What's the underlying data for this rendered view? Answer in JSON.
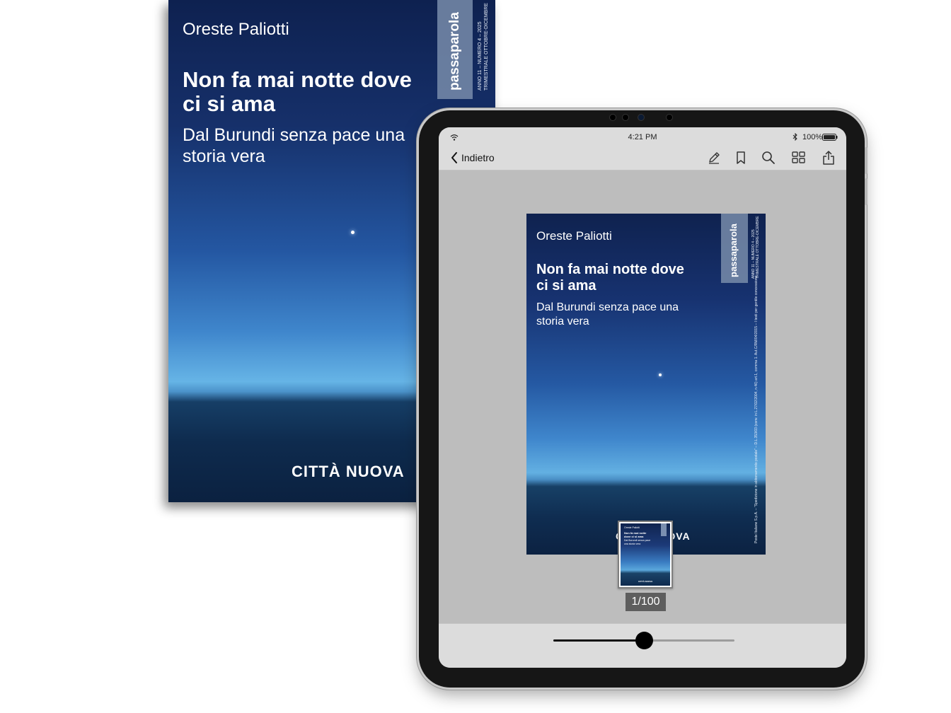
{
  "cover": {
    "author": "Oreste Paliotti",
    "title": "Non fa mai notte dove ci si ama",
    "subtitle": "Dal Burundi senza pace una storia vera",
    "publisher": "CITTÀ NUOVA",
    "magazine": "passaparola",
    "issue_line1": "ANNO 11 – NUMERO 4 – 2025",
    "issue_line2": "TRIMESTRALE OTTOBRE-DICEMBRE",
    "legal": "Poste Italiane S.p.A. – \"Spedizione in abbonamento postale\" – D.L.353/03 (conv. in L.27/02/2004, n.46) art.1, comma 1. Aut.C/RM/04/2015 – I testi per gentile concessione"
  },
  "statusbar": {
    "time": "4:21 PM",
    "battery": "100%"
  },
  "toolbar": {
    "back_label": "Indietro",
    "icons": [
      "pencil-icon",
      "bookmark-icon",
      "search-icon",
      "grid-icon",
      "share-icon"
    ]
  },
  "pager": {
    "label": "1/100",
    "current": 1,
    "total": 100
  },
  "slider": {
    "value": 0.5
  },
  "colors": {
    "accent": "#f39200",
    "chrome": "#dcdcdc",
    "reader_bg": "#bdbdbd"
  }
}
